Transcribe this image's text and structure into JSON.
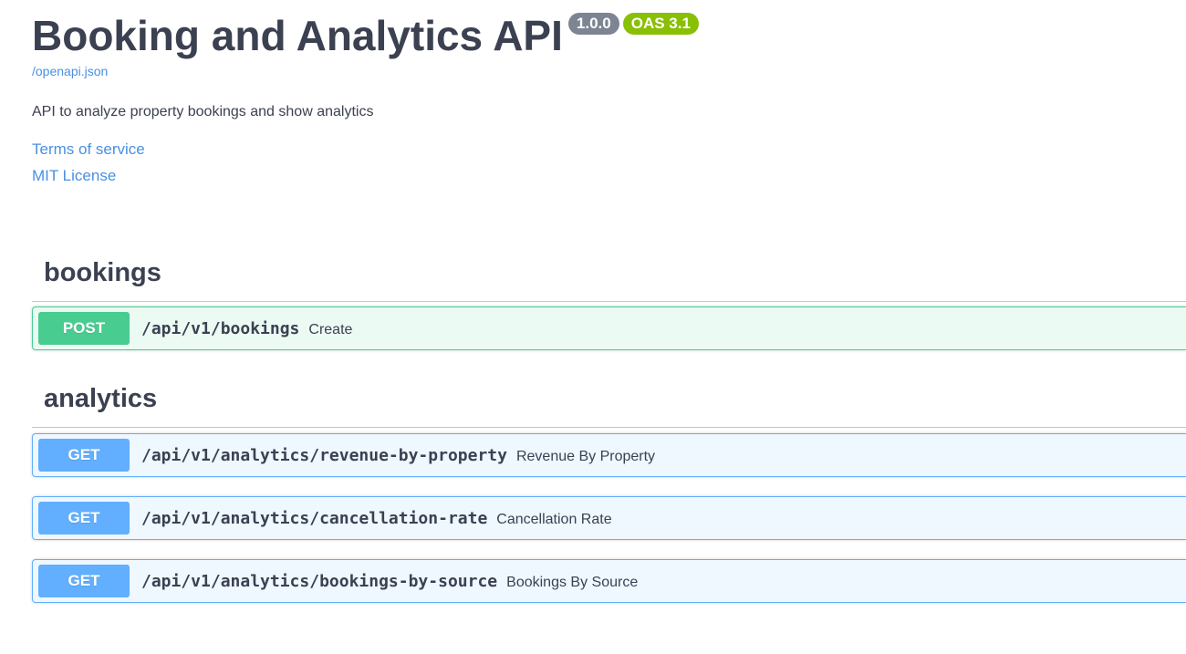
{
  "info": {
    "title": "Booking and Analytics API",
    "version_badge": "1.0.0",
    "oas_badge": "OAS 3.1",
    "spec_link": "/openapi.json",
    "description": "API to analyze property bookings and show analytics",
    "terms_link": "Terms of service",
    "license_link": "MIT License"
  },
  "tags": [
    {
      "name": "bookings",
      "operations": [
        {
          "method": "POST",
          "path": "/api/v1/bookings",
          "summary": "Create"
        }
      ]
    },
    {
      "name": "analytics",
      "operations": [
        {
          "method": "GET",
          "path": "/api/v1/analytics/revenue-by-property",
          "summary": "Revenue By Property"
        },
        {
          "method": "GET",
          "path": "/api/v1/analytics/cancellation-rate",
          "summary": "Cancellation Rate"
        },
        {
          "method": "GET",
          "path": "/api/v1/analytics/bookings-by-source",
          "summary": "Bookings By Source"
        }
      ]
    }
  ],
  "colors": {
    "post": "#49cc90",
    "get": "#61affe",
    "link": "#4990e2",
    "text": "#3b4151",
    "version_badge": "#7d8492",
    "oas_badge": "#89bf04"
  }
}
